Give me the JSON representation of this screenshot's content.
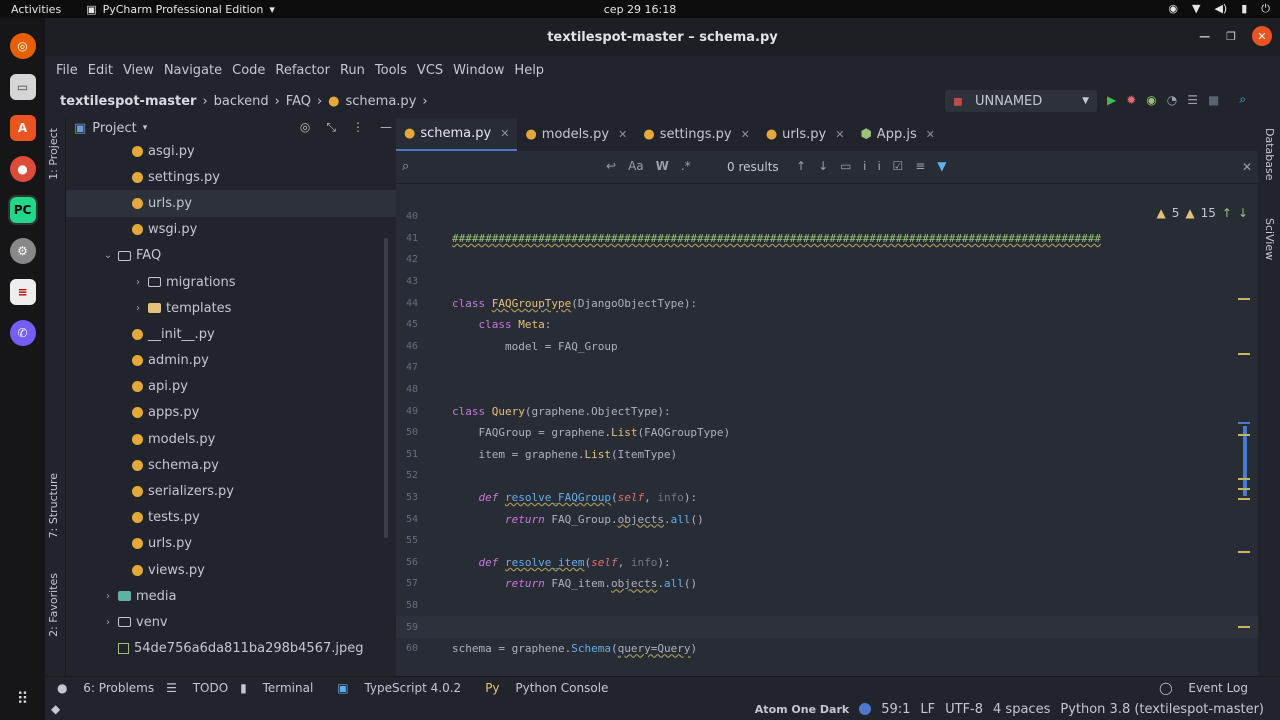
{
  "system": {
    "activities": "Activities",
    "app_name": "PyCharm Professional Edition",
    "clock": "сер 29  16:18"
  },
  "window": {
    "title": "textilespot-master – schema.py"
  },
  "menu": [
    "File",
    "Edit",
    "View",
    "Navigate",
    "Code",
    "Refactor",
    "Run",
    "Tools",
    "VCS",
    "Window",
    "Help"
  ],
  "breadcrumbs": [
    "textilespot-master",
    "backend",
    "FAQ",
    "schema.py"
  ],
  "run_config": "UNNAMED",
  "project_panel": {
    "title": "Project",
    "tree": [
      {
        "label": "asgi.py",
        "type": "py",
        "indent": 1
      },
      {
        "label": "settings.py",
        "type": "py",
        "indent": 1
      },
      {
        "label": "urls.py",
        "type": "py",
        "indent": 1,
        "selected": true
      },
      {
        "label": "wsgi.py",
        "type": "py",
        "indent": 1
      },
      {
        "label": "FAQ",
        "type": "folder",
        "indent": 0,
        "expanded": true
      },
      {
        "label": "migrations",
        "type": "folder",
        "indent": 1,
        "collapsed": true
      },
      {
        "label": "templates",
        "type": "folder-yellow",
        "indent": 1,
        "collapsed": true
      },
      {
        "label": "__init__.py",
        "type": "py",
        "indent": 1
      },
      {
        "label": "admin.py",
        "type": "py",
        "indent": 1
      },
      {
        "label": "api.py",
        "type": "py",
        "indent": 1
      },
      {
        "label": "apps.py",
        "type": "py",
        "indent": 1
      },
      {
        "label": "models.py",
        "type": "py",
        "indent": 1
      },
      {
        "label": "schema.py",
        "type": "py",
        "indent": 1
      },
      {
        "label": "serializers.py",
        "type": "py",
        "indent": 1
      },
      {
        "label": "tests.py",
        "type": "py",
        "indent": 1
      },
      {
        "label": "urls.py",
        "type": "py",
        "indent": 1
      },
      {
        "label": "views.py",
        "type": "py",
        "indent": 1
      },
      {
        "label": "media",
        "type": "folder-teal",
        "indent": 0,
        "collapsed": true
      },
      {
        "label": "venv",
        "type": "folder",
        "indent": 0,
        "collapsed": true
      },
      {
        "label": "54de756a6da811ba298b4567.jpeg",
        "type": "image",
        "indent": 0
      }
    ]
  },
  "side_tabs": {
    "project": "1: Project",
    "structure": "7: Structure",
    "favorites": "2: Favorites",
    "database": "Database",
    "sciview": "SciView"
  },
  "editor_tabs": [
    {
      "label": "schema.py",
      "active": true
    },
    {
      "label": "models.py"
    },
    {
      "label": "settings.py"
    },
    {
      "label": "urls.py"
    },
    {
      "label": "App.js"
    }
  ],
  "find": {
    "results": "0 results",
    "match_case": "Aa",
    "words": "W",
    "regex": ".*"
  },
  "inspections": {
    "warnings": "5",
    "weak_warnings": "15"
  },
  "code_lines": [
    {
      "n": "40",
      "html": ""
    },
    {
      "n": "41",
      "html": "<span class=\"cmt und\">##################################################################################################</span>"
    },
    {
      "n": "42",
      "html": ""
    },
    {
      "n": "43",
      "html": ""
    },
    {
      "n": "44",
      "html": "<span class=\"kw\">class</span> <span class=\"cls und\">FAQGroupType</span>(DjangoObjectType):"
    },
    {
      "n": "45",
      "html": "    <span class=\"kw\">class</span> <span class=\"cls\">Meta</span>:"
    },
    {
      "n": "46",
      "html": "        model = FAQ_Group"
    },
    {
      "n": "47",
      "html": ""
    },
    {
      "n": "48",
      "html": ""
    },
    {
      "n": "49",
      "html": "<span class=\"kw\">class</span> <span class=\"cls\">Query</span>(graphene.ObjectType):"
    },
    {
      "n": "50",
      "html": "    FAQGroup = graphene.<span class=\"cls\">List</span>(FAQGroupType)"
    },
    {
      "n": "51",
      "html": "    item = graphene.<span class=\"cls\">List</span>(ItemType)"
    },
    {
      "n": "52",
      "html": ""
    },
    {
      "n": "53",
      "html": "    <span class=\"kw it\">def</span> <span class=\"fn und\">resolve_FAQGroup</span>(<span class=\"self\">self</span>, <span class=\"param\">info</span>):"
    },
    {
      "n": "54",
      "html": "        <span class=\"kw it\">return</span> FAQ_Group.<span class=\"und\">objects</span>.<span class=\"fn\">all</span>()"
    },
    {
      "n": "55",
      "html": ""
    },
    {
      "n": "56",
      "html": "    <span class=\"kw it\">def</span> <span class=\"fn und\">resolve_item</span>(<span class=\"self\">self</span>, <span class=\"param\">info</span>):"
    },
    {
      "n": "57",
      "html": "        <span class=\"kw it\">return</span> FAQ_item.<span class=\"und\">objects</span>.<span class=\"fn\">all</span>()"
    },
    {
      "n": "58",
      "html": ""
    },
    {
      "n": "59",
      "html": "",
      "current": true
    },
    {
      "n": "60",
      "html": "schema = graphene.<span class=\"fn\">Schema</span>(<span class=\"und\">query=Query</span>)"
    }
  ],
  "bottom_tools": {
    "problems": "6: Problems",
    "todo": "TODO",
    "terminal": "Terminal",
    "typescript": "TypeScript 4.0.2",
    "python_console": "Python Console",
    "event_log": "Event Log"
  },
  "status": {
    "theme": "Atom One Dark",
    "position": "59:1",
    "line_sep": "LF",
    "encoding": "UTF-8",
    "indent": "4 spaces",
    "interpreter": "Python 3.8 (textilespot-master)"
  },
  "colors": {
    "accent": "#4d78cc",
    "close": "#e95420",
    "warning": "#e5c07b"
  }
}
